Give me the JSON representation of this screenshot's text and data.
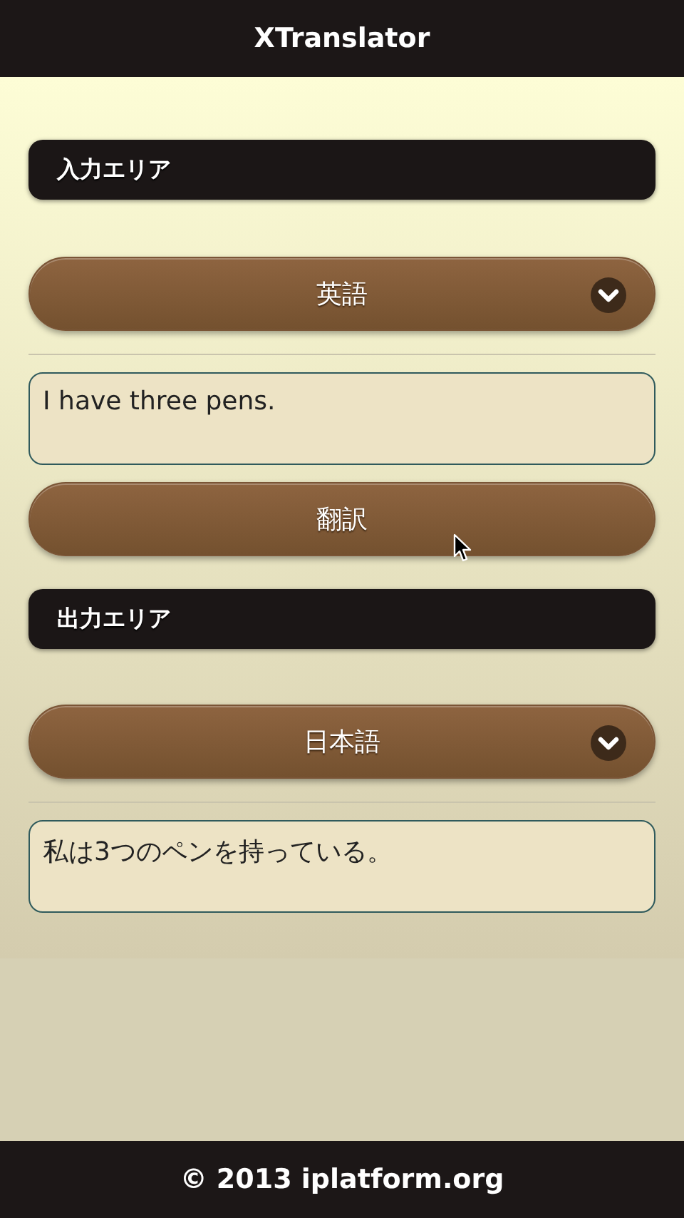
{
  "header": {
    "title": "XTranslator"
  },
  "input_area": {
    "heading": "入力エリア",
    "language": "英語",
    "text": "I have three pens."
  },
  "translate_button": {
    "label": "翻訳"
  },
  "output_area": {
    "heading": "出力エリア",
    "language": "日本語",
    "text": "私は3つのペンを持っている。"
  },
  "footer": {
    "text": "© 2013 iplatform.org"
  }
}
